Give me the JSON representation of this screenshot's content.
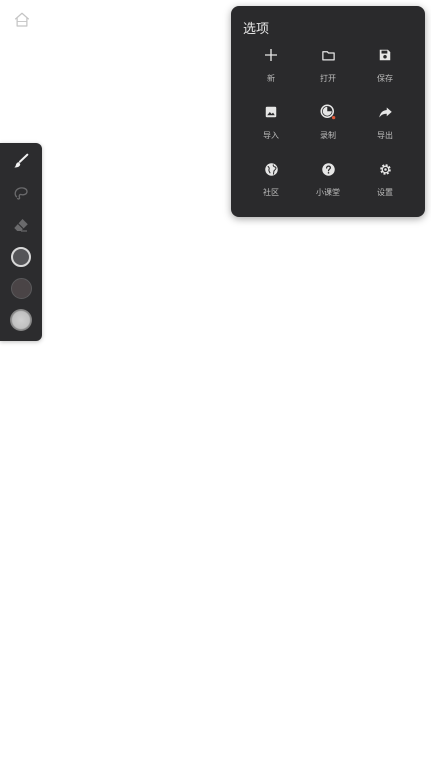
{
  "menu": {
    "title": "选项",
    "items": [
      {
        "label": "新",
        "icon": "plus-icon"
      },
      {
        "label": "打开",
        "icon": "folder-icon"
      },
      {
        "label": "保存",
        "icon": "save-icon"
      },
      {
        "label": "导入",
        "icon": "image-icon"
      },
      {
        "label": "录制",
        "icon": "record-icon"
      },
      {
        "label": "导出",
        "icon": "share-arrow-icon"
      },
      {
        "label": "社区",
        "icon": "globe-icon"
      },
      {
        "label": "小课堂",
        "icon": "help-icon"
      },
      {
        "label": "设置",
        "icon": "gear-icon"
      }
    ]
  },
  "toolbar": {
    "tools": [
      "brush-icon",
      "lasso-icon",
      "eraser-icon"
    ],
    "swatches": [
      "#555558",
      "#4a4446",
      "#bfbfbf"
    ]
  },
  "colors": {
    "panel": "#2a2a2c",
    "record_dot": "#e05a3a"
  }
}
